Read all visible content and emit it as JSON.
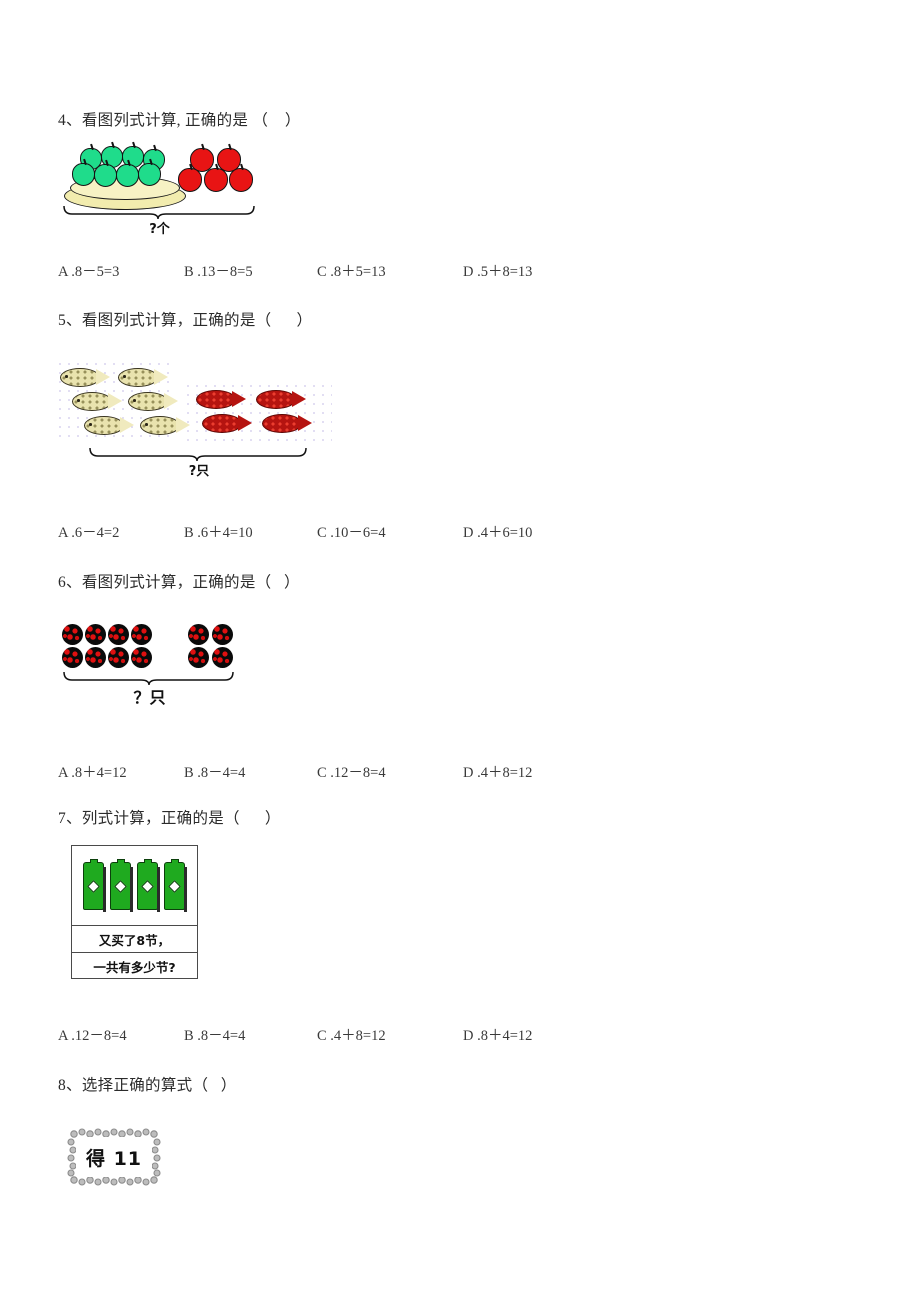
{
  "document": {
    "type": "math-worksheet",
    "language": "zh-CN"
  },
  "questions": [
    {
      "id": "q4",
      "heading": "4、看图列式计算, 正确的是 （    ）",
      "brace_label": "?个",
      "illustration": {
        "kind": "apples",
        "green_apples_on_plate": 8,
        "red_apples": 5
      },
      "options": [
        "A .8－5=3",
        "B .13－8=5",
        "C .8＋5=13",
        "D .5＋8=13"
      ]
    },
    {
      "id": "q5",
      "heading": "5、看图列式计算，正确的是（      ）",
      "brace_label": "?只",
      "illustration": {
        "kind": "fish",
        "yellow_fish": 6,
        "red_fish": 4
      },
      "options": [
        "A .6－4=2",
        "B .6＋4=10",
        "C .10－6=4",
        "D .4＋6=10"
      ]
    },
    {
      "id": "q6",
      "heading": "6、看图列式计算，正确的是（   ）",
      "brace_label": "？只",
      "illustration": {
        "kind": "balls",
        "left_group": 8,
        "right_group": 4
      },
      "options": [
        "A .8＋4=12",
        "B .8－4=4",
        "C .12－8=4",
        "D .4＋8=12"
      ]
    },
    {
      "id": "q7",
      "heading": "7、列式计算，正确的是（      ）",
      "illustration": {
        "kind": "battery-card",
        "batteries": 4,
        "line1": "又买了8节，",
        "line2": "一共有多少节?"
      },
      "options": [
        "A .12－8=4",
        "B .8－4=4",
        "C .4＋8=12",
        "D .8＋4=12"
      ]
    },
    {
      "id": "q8",
      "heading": "8、选择正确的算式（   ）",
      "illustration": {
        "kind": "scallop-box",
        "text": "得 11"
      }
    }
  ],
  "colors": {
    "page_background": "#ffffff",
    "text": "#2b2b2b",
    "apple_green": "#1fdc8b",
    "apple_red": "#e81414",
    "plate_yellow": "#f2ecae",
    "fish_yellow": "#e9e3ae",
    "fish_red": "#b51410",
    "ball_black": "#0a0a0a",
    "ball_red": "#e01010",
    "battery_green": "#1faa1f",
    "border_gray": "#4a4a4a"
  }
}
